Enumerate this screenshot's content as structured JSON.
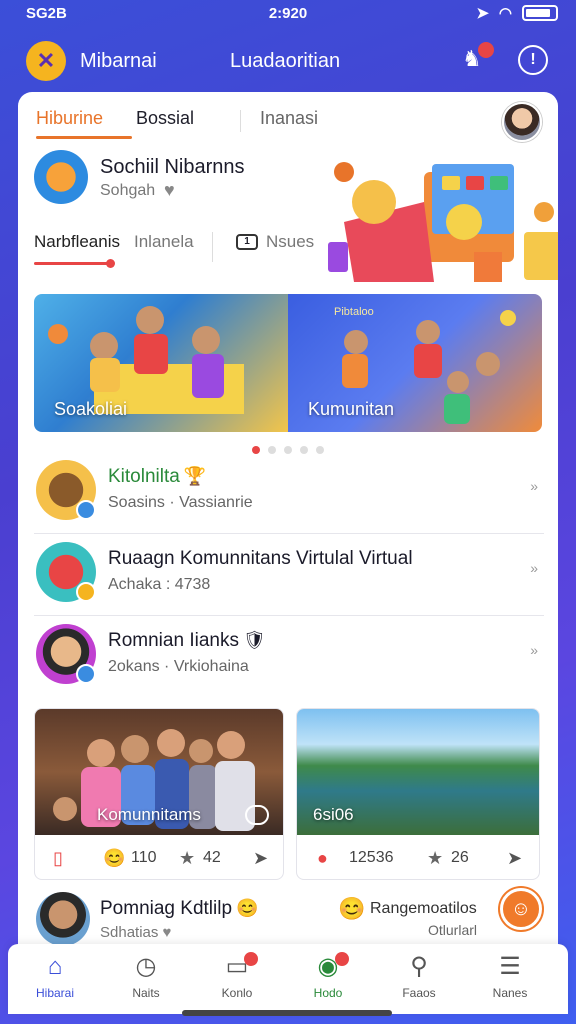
{
  "statusbar": {
    "carrier": "SG2B",
    "time": "2:920"
  },
  "header": {
    "title": "Mibarnai",
    "center_title": "Luadaoritian"
  },
  "tabs": [
    "Hiburine",
    "Bossial",
    "Inanasi"
  ],
  "feature": {
    "title": "Sochiil Nibarnns",
    "subtitle": "Sohgah",
    "subtabs": [
      "Narbfleanis",
      "Inlanela",
      "Nsues"
    ]
  },
  "banner": {
    "slides": [
      "Soakoliai",
      "Kumunitan"
    ],
    "badge": "Pibtaloo"
  },
  "list": [
    {
      "title": "Kitolnilta",
      "subtitle": "Soasins · Vassianrie"
    },
    {
      "title": "Ruaagn Komunnitans Virtulal Virtual",
      "subtitle": "Achaka : 4738"
    },
    {
      "title": "Romnian Iianks",
      "subtitle": "2okans · Vrkiohaina"
    }
  ],
  "grid": [
    {
      "label": "Komunnitams",
      "stat1": "110",
      "stat2": "42"
    },
    {
      "label": "6si06",
      "stat1": "12536",
      "stat2": "26"
    }
  ],
  "last_item": {
    "title": "Pomniag Kdtlilp",
    "subtitle": "Sdhatias",
    "right_title": "Rangemoatilos",
    "right_sub": "Otlurlarl"
  },
  "nav": [
    {
      "label": "Hibarai",
      "icon": "home-icon"
    },
    {
      "label": "Naits",
      "icon": "clock-icon"
    },
    {
      "label": "Konlo",
      "icon": "inbox-icon"
    },
    {
      "label": "Hodo",
      "icon": "map-pin-icon"
    },
    {
      "label": "Faaos",
      "icon": "search-icon"
    },
    {
      "label": "Nanes",
      "icon": "menu-icon"
    }
  ],
  "colors": {
    "accent": "#3b4fd8",
    "orange": "#e8742a",
    "red": "#e84545"
  }
}
